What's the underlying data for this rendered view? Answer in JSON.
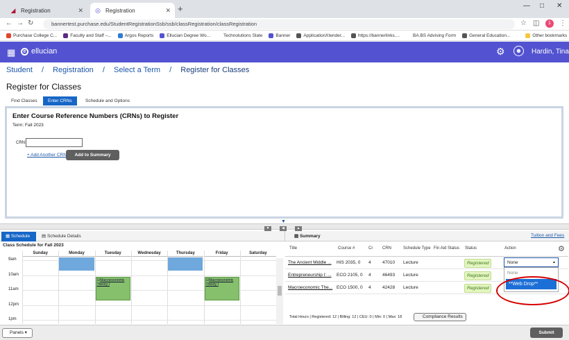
{
  "browser": {
    "tabs": [
      {
        "title": "Registration",
        "icon": "purchase-icon"
      },
      {
        "title": "Registration",
        "icon": "ellucian-icon"
      }
    ],
    "url": "bannertest.purchase.edu/StudentRegistrationSsb/ssb/classRegistration/classRegistration",
    "profile_initial": "1",
    "bookmarks": [
      {
        "label": "Purchase College C...",
        "color": "#e0452b"
      },
      {
        "label": "Faculty and Staff –...",
        "color": "#5b2a86"
      },
      {
        "label": "Argos Reports",
        "color": "#2b7bd6"
      },
      {
        "label": "Ellucian Degree Wo...",
        "color": "#5353d1"
      },
      {
        "label": "Technolutions Slate",
        "color": "#ffffff"
      },
      {
        "label": "Banner",
        "color": "#5353d1"
      },
      {
        "label": "ApplicationXtender...",
        "color": "#555555"
      },
      {
        "label": "https://bannerlinks....",
        "color": "#555555"
      },
      {
        "label": "BA.BS Advising Form",
        "color": "#ffffff"
      },
      {
        "label": "General Education...",
        "color": "#555555"
      }
    ],
    "other_bookmarks": "Other bookmarks"
  },
  "app": {
    "brand": "ellucian",
    "user": "Hardin, Tina",
    "header_color": "#5353d1"
  },
  "breadcrumb": [
    "Student",
    "Registration",
    "Select a Term",
    "Register for Classes"
  ],
  "page_title": "Register for Classes",
  "subtabs": [
    "Find Classes",
    "Enter CRNs",
    "Schedule and Options"
  ],
  "enter_crns": {
    "heading": "Enter Course Reference Numbers (CRNs) to Register",
    "term": "Term: Fall 2023",
    "crn_label": "CRN:",
    "crn_value": "",
    "add_link": "+ Add Another CRN",
    "add_button": "Add to Summary"
  },
  "schedule": {
    "tab_schedule": "Schedule",
    "tab_details": "Schedule Details",
    "title": "Class Schedule for Fall 2023",
    "days": [
      "Sunday",
      "Monday",
      "Tuesday",
      "Wednesday",
      "Thursday",
      "Friday",
      "Saturday"
    ],
    "times": [
      "9am",
      "10am",
      "11am",
      "12pm",
      "1pm"
    ],
    "events": [
      {
        "day": "Tuesday",
        "label": "Macroeconomic Theory I"
      },
      {
        "day": "Friday",
        "label": "Macroeconomic Theory I"
      }
    ]
  },
  "summary": {
    "title": "Summary",
    "tuition_link": "Tuition and Fees",
    "columns": [
      "Title",
      "Course #",
      "Cr",
      "CRN",
      "Schedule Type",
      "Fin Aid Status",
      "Status",
      "Action"
    ],
    "rows": [
      {
        "title": "The Ancient Middle ...",
        "course": "HIS 2035, 0",
        "cr": "4",
        "crn": "47010",
        "type": "Lecture",
        "status": "Registered"
      },
      {
        "title": "Entrepreneurship I: ...",
        "course": "ECO 2105, 0",
        "cr": "4",
        "crn": "46493",
        "type": "Lecture",
        "status": "Registered"
      },
      {
        "title": "Macroeconomic The...",
        "course": "ECO 1500, 0",
        "cr": "4",
        "crn": "42428",
        "type": "Lecture",
        "status": "Registered"
      }
    ],
    "action_selected": "None",
    "action_options": [
      "None",
      "**Web Drop**"
    ],
    "totals": "Total Hours | Registered: 12 | Billing: 12 | CEU: 0 | Min: 0 | Max: 18",
    "compliance_button": "Compliance Results"
  },
  "footer": {
    "panels": "Panels",
    "submit": "Submit"
  }
}
